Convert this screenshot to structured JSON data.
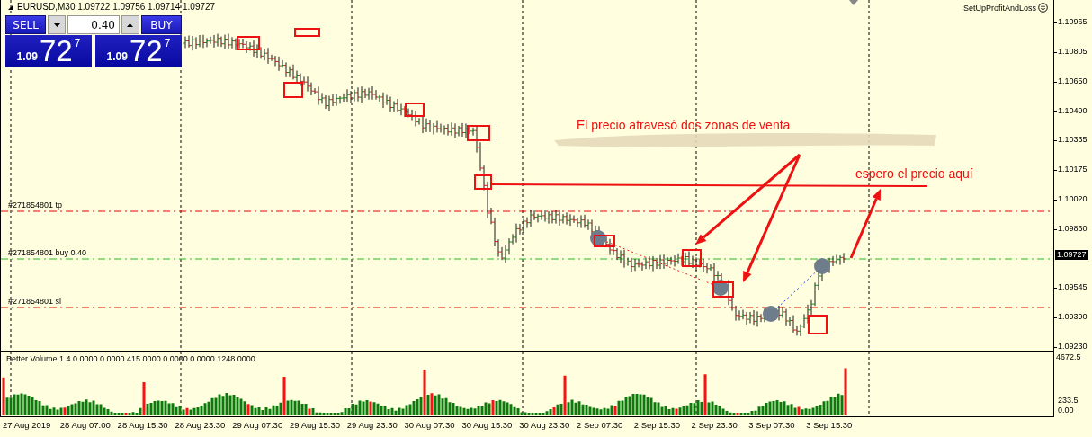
{
  "chart": {
    "title": "EURUSD,M30 1.09722 1.09756 1.09714 1.09727",
    "expert": "SetUpProfitAndLoss",
    "trade_panel": {
      "sell_label": "SELL",
      "buy_label": "BUY",
      "lot": "0.40",
      "sell_price": {
        "prefix": "1.09",
        "main": "72",
        "sup": "7"
      },
      "buy_price": {
        "prefix": "1.09",
        "main": "72",
        "sup": "7"
      }
    },
    "order_lines": [
      {
        "label": "#271854801 tp",
        "kind": "tp"
      },
      {
        "label": "#271854801 buy 0.40",
        "kind": "buy"
      },
      {
        "label": "#271854801 sl",
        "kind": "sl"
      }
    ],
    "annotations": [
      "El precio atravesó dos zonas de venta",
      "espero el precio aquí"
    ],
    "price_axis": [
      "1.10965",
      "1.10805",
      "1.10650",
      "1.10490",
      "1.10335",
      "1.10175",
      "1.10020",
      "1.09860",
      "1.09545",
      "1.09390",
      "1.09230"
    ],
    "current_price": "1.09727"
  },
  "volume_pane": {
    "label": "Better Volume 1.4 0.0000 0.0000 415.0000 0.0000 0.0000 1248.0000",
    "axis": [
      "4672.5",
      "233.5",
      "0.00"
    ]
  },
  "time_axis": [
    "27 Aug 2019",
    "28 Aug 07:00",
    "28 Aug 15:30",
    "28 Aug 23:30",
    "29 Aug 07:30",
    "29 Aug 15:30",
    "29 Aug 23:30",
    "30 Aug 07:30",
    "30 Aug 15:30",
    "30 Aug 23:30",
    "2 Sep 07:30",
    "2 Sep 15:30",
    "2 Sep 23:30",
    "3 Sep 07:30",
    "3 Sep 15:30"
  ]
}
